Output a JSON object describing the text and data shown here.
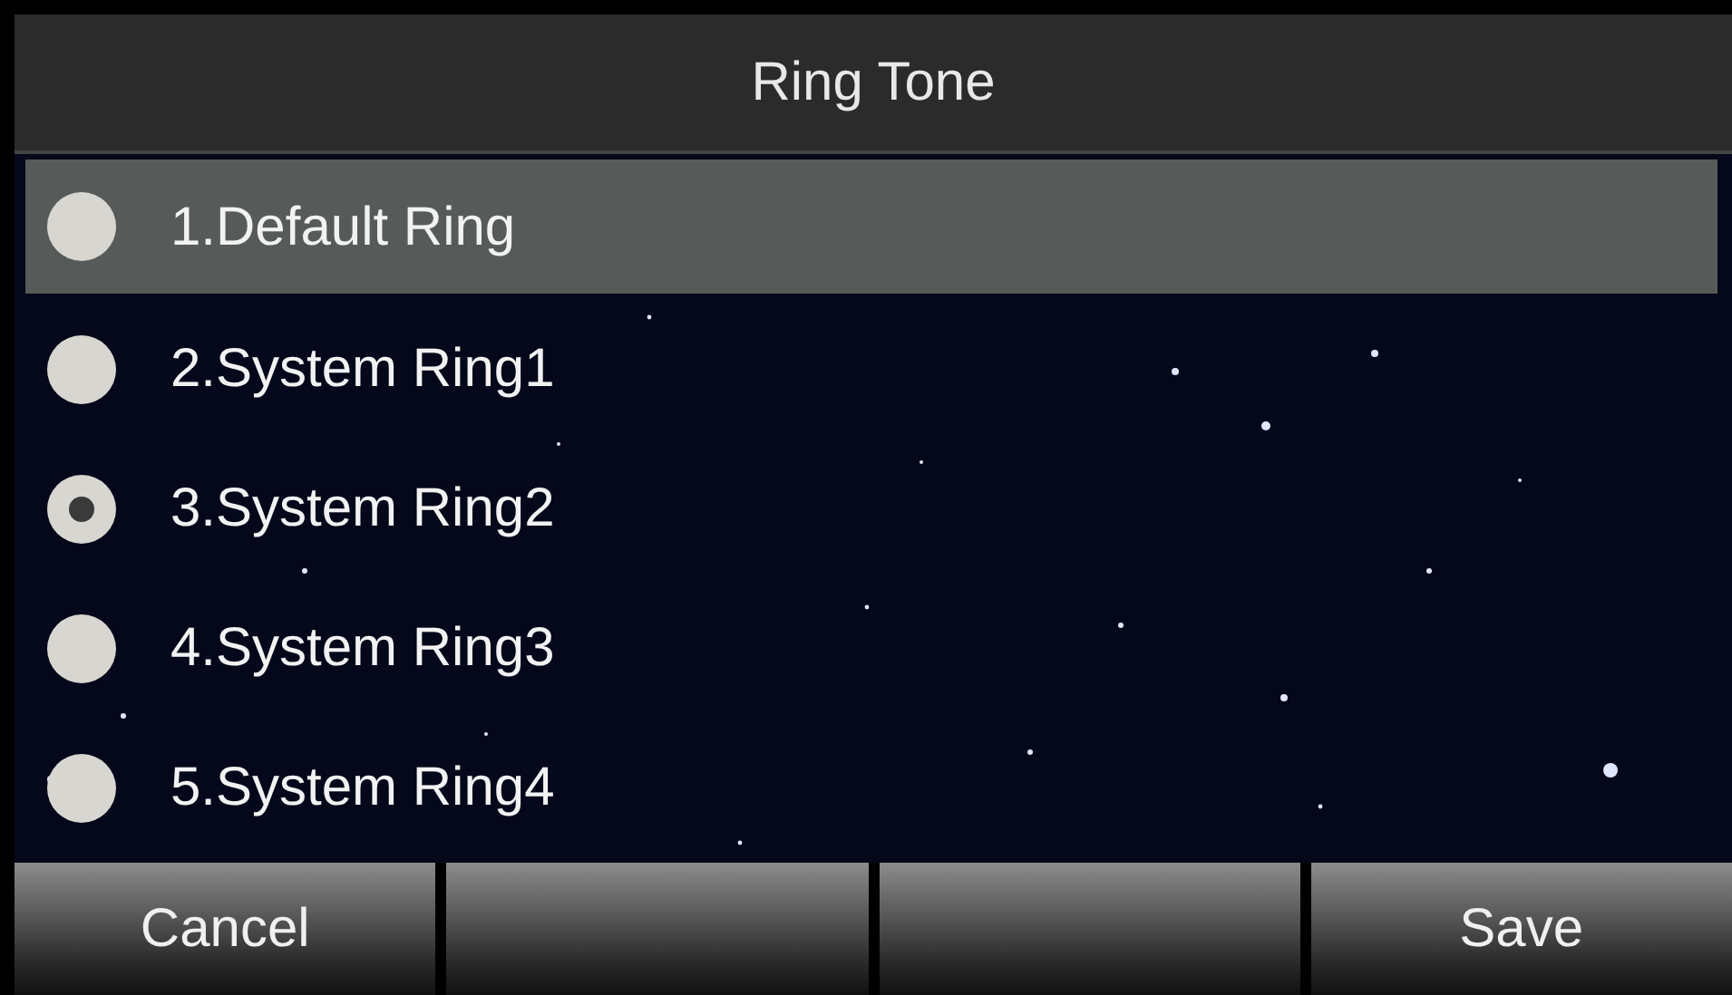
{
  "title": "Ring Tone",
  "items": [
    {
      "label": "1.Default Ring",
      "highlighted": true,
      "selected": false
    },
    {
      "label": "2.System Ring1",
      "highlighted": false,
      "selected": false
    },
    {
      "label": "3.System Ring2",
      "highlighted": false,
      "selected": true
    },
    {
      "label": "4.System Ring3",
      "highlighted": false,
      "selected": false
    },
    {
      "label": "5.System Ring4",
      "highlighted": false,
      "selected": false
    }
  ],
  "softkeys": [
    {
      "kind": "labeled",
      "label": "Cancel"
    },
    {
      "kind": "blank"
    },
    {
      "kind": "blank"
    },
    {
      "kind": "labeled",
      "label": "Save"
    }
  ]
}
